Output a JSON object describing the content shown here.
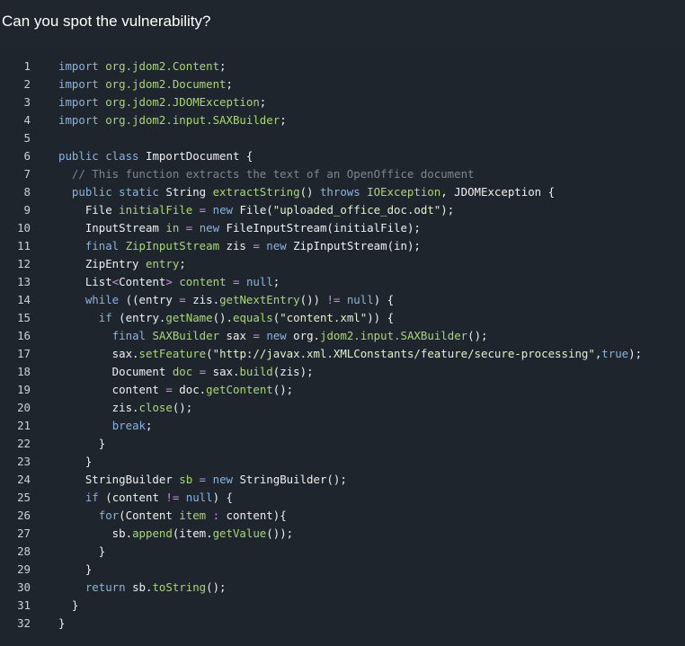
{
  "heading": "Can you spot the vulnerability?",
  "colors": {
    "background": "#20262d",
    "keyword": "#86b4e6",
    "package": "#a9d96a",
    "comment": "#7c8791",
    "string": "#e6eec8",
    "operator": "#d08af0",
    "text": "#f0f0f0"
  },
  "code": {
    "language": "java",
    "lines": [
      {
        "n": "1",
        "tokens": [
          [
            "k",
            "import "
          ],
          [
            "p",
            "org.jdom2.Content"
          ],
          [
            "w",
            ";"
          ]
        ]
      },
      {
        "n": "2",
        "tokens": [
          [
            "k",
            "import "
          ],
          [
            "p",
            "org.jdom2.Document"
          ],
          [
            "w",
            ";"
          ]
        ]
      },
      {
        "n": "3",
        "tokens": [
          [
            "k",
            "import "
          ],
          [
            "p",
            "org.jdom2.JDOMException"
          ],
          [
            "w",
            ";"
          ]
        ]
      },
      {
        "n": "4",
        "tokens": [
          [
            "k",
            "import "
          ],
          [
            "p",
            "org.jdom2.input.SAXBuilder"
          ],
          [
            "w",
            ";"
          ]
        ]
      },
      {
        "n": "5",
        "tokens": []
      },
      {
        "n": "6",
        "tokens": [
          [
            "k",
            "public class "
          ],
          [
            "w",
            "ImportDocument {"
          ]
        ]
      },
      {
        "n": "7",
        "tokens": [
          [
            "w",
            "  "
          ],
          [
            "c",
            "// This function extracts the text of an OpenOffice document"
          ]
        ]
      },
      {
        "n": "8",
        "tokens": [
          [
            "w",
            "  "
          ],
          [
            "k",
            "public static "
          ],
          [
            "w",
            "String "
          ],
          [
            "f",
            "extractString"
          ],
          [
            "w",
            "() "
          ],
          [
            "k",
            "throws "
          ],
          [
            "p",
            "IOException"
          ],
          [
            "w",
            ", JDOMException {"
          ]
        ]
      },
      {
        "n": "9",
        "tokens": [
          [
            "w",
            "    File "
          ],
          [
            "f",
            "initialFile"
          ],
          [
            "w",
            " "
          ],
          [
            "op",
            "="
          ],
          [
            "w",
            " "
          ],
          [
            "k",
            "new "
          ],
          [
            "w",
            "File("
          ],
          [
            "s",
            "\"uploaded_office_doc.odt\""
          ],
          [
            "w",
            ");"
          ]
        ]
      },
      {
        "n": "10",
        "tokens": [
          [
            "w",
            "    InputStream "
          ],
          [
            "f",
            "in"
          ],
          [
            "w",
            " "
          ],
          [
            "op",
            "="
          ],
          [
            "w",
            " "
          ],
          [
            "k",
            "new "
          ],
          [
            "w",
            "FileInputStream(initialFile);"
          ]
        ]
      },
      {
        "n": "11",
        "tokens": [
          [
            "w",
            "    "
          ],
          [
            "k",
            "final "
          ],
          [
            "p",
            "ZipInputStream"
          ],
          [
            "w",
            " zis "
          ],
          [
            "op",
            "="
          ],
          [
            "w",
            " "
          ],
          [
            "k",
            "new "
          ],
          [
            "w",
            "ZipInputStream(in);"
          ]
        ]
      },
      {
        "n": "12",
        "tokens": [
          [
            "w",
            "    ZipEntry "
          ],
          [
            "f",
            "entry"
          ],
          [
            "w",
            ";"
          ]
        ]
      },
      {
        "n": "13",
        "tokens": [
          [
            "w",
            "    List"
          ],
          [
            "op",
            "<"
          ],
          [
            "w",
            "Content"
          ],
          [
            "op",
            ">"
          ],
          [
            "w",
            " "
          ],
          [
            "f",
            "content"
          ],
          [
            "w",
            " "
          ],
          [
            "op",
            "="
          ],
          [
            "w",
            " "
          ],
          [
            "k",
            "null"
          ],
          [
            "w",
            ";"
          ]
        ]
      },
      {
        "n": "14",
        "tokens": [
          [
            "w",
            "    "
          ],
          [
            "k",
            "while "
          ],
          [
            "w",
            "((entry "
          ],
          [
            "op",
            "="
          ],
          [
            "w",
            " zis."
          ],
          [
            "f",
            "getNextEntry"
          ],
          [
            "w",
            "()) "
          ],
          [
            "op",
            "!="
          ],
          [
            "w",
            " "
          ],
          [
            "k",
            "null"
          ],
          [
            "w",
            ") {"
          ]
        ]
      },
      {
        "n": "15",
        "tokens": [
          [
            "w",
            "      "
          ],
          [
            "k",
            "if "
          ],
          [
            "w",
            "(entry."
          ],
          [
            "f",
            "getName"
          ],
          [
            "w",
            "()."
          ],
          [
            "f",
            "equals"
          ],
          [
            "w",
            "("
          ],
          [
            "s",
            "\"content.xml\""
          ],
          [
            "w",
            ")) {"
          ]
        ]
      },
      {
        "n": "16",
        "tokens": [
          [
            "w",
            "        "
          ],
          [
            "k",
            "final "
          ],
          [
            "p",
            "SAXBuilder"
          ],
          [
            "w",
            " sax "
          ],
          [
            "op",
            "="
          ],
          [
            "w",
            " "
          ],
          [
            "k",
            "new "
          ],
          [
            "w",
            "org."
          ],
          [
            "p",
            "jdom2.input.SAXBuilder"
          ],
          [
            "w",
            "();"
          ]
        ]
      },
      {
        "n": "17",
        "tokens": [
          [
            "w",
            "        sax."
          ],
          [
            "f",
            "setFeature"
          ],
          [
            "w",
            "("
          ],
          [
            "s",
            "\"http://javax.xml.XMLConstants/feature/secure-processing\""
          ],
          [
            "w",
            ","
          ],
          [
            "k",
            "true"
          ],
          [
            "w",
            ");"
          ]
        ]
      },
      {
        "n": "18",
        "tokens": [
          [
            "w",
            "        Document "
          ],
          [
            "f",
            "doc"
          ],
          [
            "w",
            " "
          ],
          [
            "op",
            "="
          ],
          [
            "w",
            " sax."
          ],
          [
            "f",
            "build"
          ],
          [
            "w",
            "(zis);"
          ]
        ]
      },
      {
        "n": "19",
        "tokens": [
          [
            "w",
            "        content "
          ],
          [
            "op",
            "="
          ],
          [
            "w",
            " doc."
          ],
          [
            "f",
            "getContent"
          ],
          [
            "w",
            "();"
          ]
        ]
      },
      {
        "n": "20",
        "tokens": [
          [
            "w",
            "        zis."
          ],
          [
            "f",
            "close"
          ],
          [
            "w",
            "();"
          ]
        ]
      },
      {
        "n": "21",
        "tokens": [
          [
            "w",
            "        "
          ],
          [
            "k",
            "break"
          ],
          [
            "w",
            ";"
          ]
        ]
      },
      {
        "n": "22",
        "tokens": [
          [
            "w",
            "      }"
          ]
        ]
      },
      {
        "n": "23",
        "tokens": [
          [
            "w",
            "    }"
          ]
        ]
      },
      {
        "n": "24",
        "tokens": [
          [
            "w",
            "    StringBuilder "
          ],
          [
            "f",
            "sb"
          ],
          [
            "w",
            " "
          ],
          [
            "op",
            "="
          ],
          [
            "w",
            " "
          ],
          [
            "k",
            "new "
          ],
          [
            "w",
            "StringBuilder();"
          ]
        ]
      },
      {
        "n": "25",
        "tokens": [
          [
            "w",
            "    "
          ],
          [
            "k",
            "if "
          ],
          [
            "w",
            "(content "
          ],
          [
            "op",
            "!="
          ],
          [
            "w",
            " "
          ],
          [
            "k",
            "null"
          ],
          [
            "w",
            ") {"
          ]
        ]
      },
      {
        "n": "26",
        "tokens": [
          [
            "w",
            "      "
          ],
          [
            "k",
            "for"
          ],
          [
            "w",
            "(Content "
          ],
          [
            "f",
            "item"
          ],
          [
            "w",
            " "
          ],
          [
            "op",
            ":"
          ],
          [
            "w",
            " content){"
          ]
        ]
      },
      {
        "n": "27",
        "tokens": [
          [
            "w",
            "        sb."
          ],
          [
            "f",
            "append"
          ],
          [
            "w",
            "(item."
          ],
          [
            "f",
            "getValue"
          ],
          [
            "w",
            "());"
          ]
        ]
      },
      {
        "n": "28",
        "tokens": [
          [
            "w",
            "      }"
          ]
        ]
      },
      {
        "n": "29",
        "tokens": [
          [
            "w",
            "    }"
          ]
        ]
      },
      {
        "n": "30",
        "tokens": [
          [
            "w",
            "    "
          ],
          [
            "k",
            "return "
          ],
          [
            "w",
            "sb."
          ],
          [
            "f",
            "toString"
          ],
          [
            "w",
            "();"
          ]
        ]
      },
      {
        "n": "31",
        "tokens": [
          [
            "w",
            "  }"
          ]
        ]
      },
      {
        "n": "32",
        "tokens": [
          [
            "w",
            "}"
          ]
        ]
      }
    ]
  }
}
